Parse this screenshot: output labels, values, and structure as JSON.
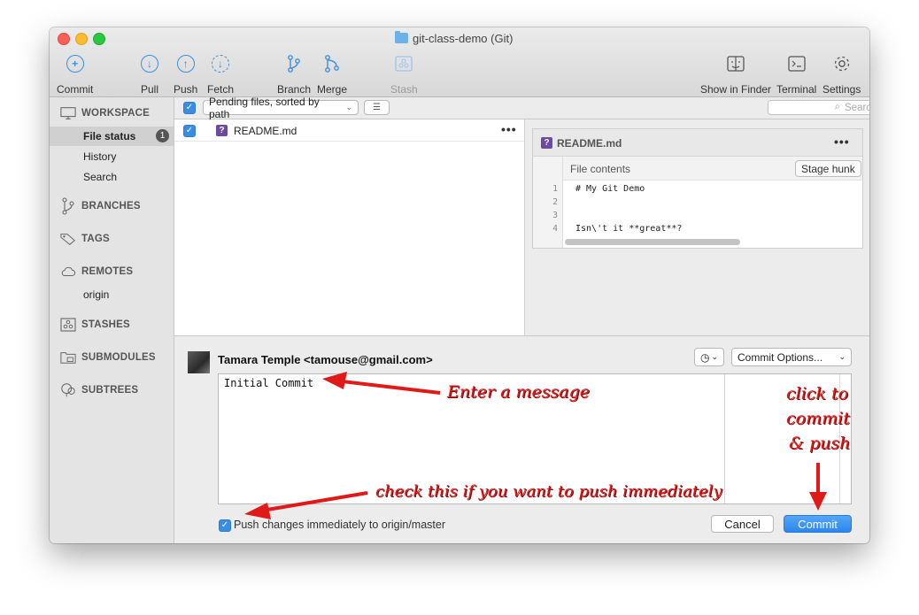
{
  "window": {
    "title": "git-class-demo (Git)"
  },
  "toolbar": {
    "commit": "Commit",
    "pull": "Pull",
    "push": "Push",
    "fetch": "Fetch",
    "branch": "Branch",
    "merge": "Merge",
    "stash": "Stash",
    "show_in_finder": "Show in Finder",
    "terminal": "Terminal",
    "settings": "Settings"
  },
  "sidebar": {
    "workspace": "WORKSPACE",
    "file_status": "File status",
    "file_status_badge": "1",
    "history": "History",
    "search": "Search",
    "branches": "BRANCHES",
    "tags": "TAGS",
    "remotes": "REMOTES",
    "origin": "origin",
    "stashes": "STASHES",
    "submodules": "SUBMODULES",
    "subtrees": "SUBTREES"
  },
  "filter": {
    "sort_label": "Pending files, sorted by path",
    "search_placeholder": "Search"
  },
  "files": [
    {
      "name": "README.md",
      "status_icon": "?"
    }
  ],
  "preview": {
    "file_name": "README.md",
    "file_contents_label": "File contents",
    "stage_hunk": "Stage hunk",
    "lines": [
      {
        "num": "1",
        "text": "# My Git Demo"
      },
      {
        "num": "2",
        "text": ""
      },
      {
        "num": "3",
        "text": ""
      },
      {
        "num": "4",
        "text": "Isn\\'t it **great**?"
      }
    ]
  },
  "commit": {
    "author": "Tamara Temple <tamouse@gmail.com>",
    "options_label": "Commit Options...",
    "message": "Initial Commit",
    "push_checkbox_label": "Push changes immediately to origin/master",
    "cancel": "Cancel",
    "commit": "Commit"
  },
  "annotations": {
    "enter_message": "Enter a message",
    "click_line1": "click to",
    "click_line2": "commit",
    "click_line3": "& push",
    "check_push": "check this if you want to push immediately"
  },
  "colors": {
    "accent": "#3b8de3",
    "annotation": "#e01919",
    "file_icon": "#6b4aa0"
  }
}
